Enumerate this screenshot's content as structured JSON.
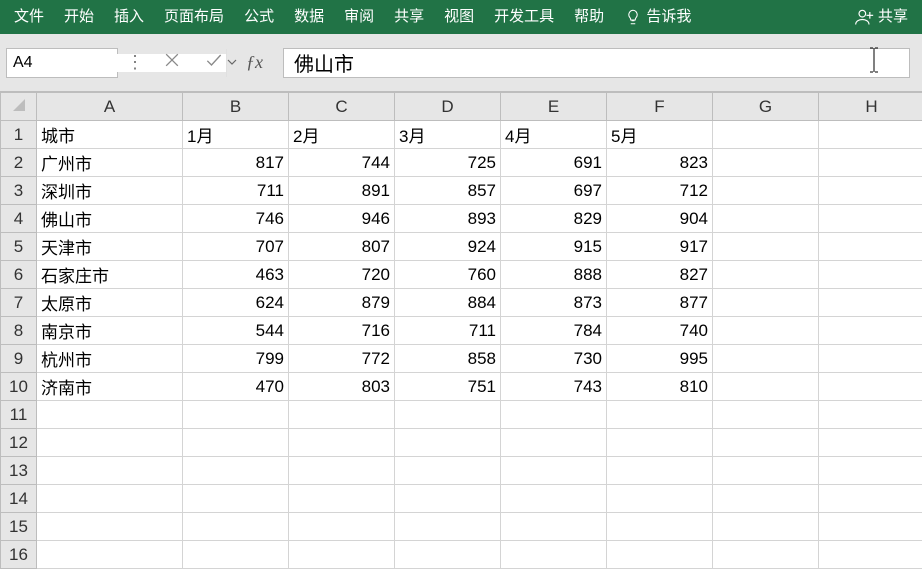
{
  "ribbon": {
    "tabs": [
      "文件",
      "开始",
      "插入",
      "页面布局",
      "公式",
      "数据",
      "审阅",
      "共享",
      "视图",
      "开发工具",
      "帮助"
    ],
    "tell_me": "告诉我",
    "share": "共享"
  },
  "formula_bar": {
    "name_box": "A4",
    "formula": "佛山市"
  },
  "grid": {
    "columns": [
      "A",
      "B",
      "C",
      "D",
      "E",
      "F",
      "G",
      "H"
    ],
    "row_count": 16,
    "headers": {
      "A": "城市",
      "B": "1月",
      "C": "2月",
      "D": "3月",
      "E": "4月",
      "F": "5月"
    },
    "rows": [
      {
        "city": "广州市",
        "v": [
          817,
          744,
          725,
          691,
          823
        ]
      },
      {
        "city": "深圳市",
        "v": [
          711,
          891,
          857,
          697,
          712
        ]
      },
      {
        "city": "佛山市",
        "v": [
          746,
          946,
          893,
          829,
          904
        ]
      },
      {
        "city": "天津市",
        "v": [
          707,
          807,
          924,
          915,
          917
        ]
      },
      {
        "city": "石家庄市",
        "v": [
          463,
          720,
          760,
          888,
          827
        ]
      },
      {
        "city": "太原市",
        "v": [
          624,
          879,
          884,
          873,
          877
        ]
      },
      {
        "city": "南京市",
        "v": [
          544,
          716,
          711,
          784,
          740
        ]
      },
      {
        "city": "杭州市",
        "v": [
          799,
          772,
          858,
          730,
          995
        ]
      },
      {
        "city": "济南市",
        "v": [
          470,
          803,
          751,
          743,
          810
        ]
      }
    ]
  },
  "chart_data": {
    "type": "table",
    "title": "",
    "columns": [
      "城市",
      "1月",
      "2月",
      "3月",
      "4月",
      "5月"
    ],
    "rows": [
      [
        "广州市",
        817,
        744,
        725,
        691,
        823
      ],
      [
        "深圳市",
        711,
        891,
        857,
        697,
        712
      ],
      [
        "佛山市",
        746,
        946,
        893,
        829,
        904
      ],
      [
        "天津市",
        707,
        807,
        924,
        915,
        917
      ],
      [
        "石家庄市",
        463,
        720,
        760,
        888,
        827
      ],
      [
        "太原市",
        624,
        879,
        884,
        873,
        877
      ],
      [
        "南京市",
        544,
        716,
        711,
        784,
        740
      ],
      [
        "杭州市",
        799,
        772,
        858,
        730,
        995
      ],
      [
        "济南市",
        470,
        803,
        751,
        743,
        810
      ]
    ]
  }
}
